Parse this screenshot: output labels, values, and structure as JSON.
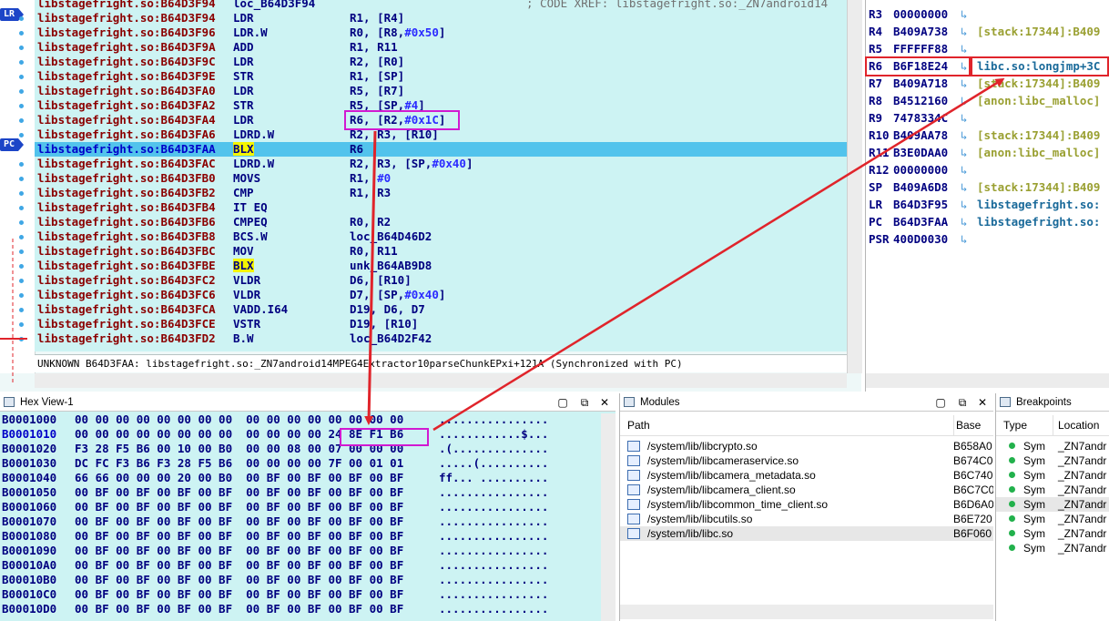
{
  "disasm": {
    "rows": [
      {
        "addr": "libstagefright.so:B64D3F94",
        "mn": "loc_B64D3F94",
        "ops": "",
        "cmt": "; CODE XREF: libstagefright.so:_ZN7android14"
      },
      {
        "addr": "libstagefright.so:B64D3F94",
        "mn": "LDR",
        "ops": "R1, [R4]"
      },
      {
        "addr": "libstagefright.so:B64D3F96",
        "mn": "LDR.W",
        "ops": "R0, [R8,",
        "imm": "#0x50",
        "tail": "]"
      },
      {
        "addr": "libstagefright.so:B64D3F9A",
        "mn": "ADD",
        "ops": "R1, R11"
      },
      {
        "addr": "libstagefright.so:B64D3F9C",
        "mn": "LDR",
        "ops": "R2, [R0]"
      },
      {
        "addr": "libstagefright.so:B64D3F9E",
        "mn": "STR",
        "ops": "R1, [SP]"
      },
      {
        "addr": "libstagefright.so:B64D3FA0",
        "mn": "LDR",
        "ops": "R5, [R7]"
      },
      {
        "addr": "libstagefright.so:B64D3FA2",
        "mn": "STR",
        "ops": "R5, [SP,",
        "imm": "#4",
        "tail": "]"
      },
      {
        "addr": "libstagefright.so:B64D3FA4",
        "mn": "LDR",
        "ops": "R6, [R2,",
        "imm": "#0x1C",
        "tail": "]"
      },
      {
        "addr": "libstagefright.so:B64D3FA6",
        "mn": "LDRD.W",
        "ops": "R2, R3, [R10]"
      },
      {
        "addr": "libstagefright.so:B64D3FAA",
        "mn": "BLX",
        "ops": "R6"
      },
      {
        "addr": "libstagefright.so:B64D3FAC",
        "mn": "LDRD.W",
        "ops": "R2, R3, [SP,",
        "imm": "#0x40",
        "tail": "]"
      },
      {
        "addr": "libstagefright.so:B64D3FB0",
        "mn": "MOVS",
        "ops": "R1, ",
        "imm": "#0",
        "tail": ""
      },
      {
        "addr": "libstagefright.so:B64D3FB2",
        "mn": "CMP",
        "ops": "R1, R3"
      },
      {
        "addr": "libstagefright.so:B64D3FB4",
        "mn": "IT EQ",
        "ops": ""
      },
      {
        "addr": "libstagefright.so:B64D3FB6",
        "mn": "CMPEQ",
        "ops": "R0, R2"
      },
      {
        "addr": "libstagefright.so:B64D3FB8",
        "mn": "BCS.W",
        "ops": "loc_B64D46D2"
      },
      {
        "addr": "libstagefright.so:B64D3FBC",
        "mn": "MOV",
        "ops": "R0, R11"
      },
      {
        "addr": "libstagefright.so:B64D3FBE",
        "mn": "BLX",
        "ops": "unk_B64AB9D8"
      },
      {
        "addr": "libstagefright.so:B64D3FC2",
        "mn": "VLDR",
        "ops": "D6, [R10]"
      },
      {
        "addr": "libstagefright.so:B64D3FC6",
        "mn": "VLDR",
        "ops": "D7, [SP,",
        "imm": "#0x40",
        "tail": "]"
      },
      {
        "addr": "libstagefright.so:B64D3FCA",
        "mn": "VADD.I64",
        "ops": "D19, D6, D7"
      },
      {
        "addr": "libstagefright.so:B64D3FCE",
        "mn": "VSTR",
        "ops": "D19, [R10]"
      },
      {
        "addr": "libstagefright.so:B64D3FD2",
        "mn": "B.W",
        "ops": "loc_B64D2F42"
      }
    ],
    "status": "UNKNOWN B64D3FAA: libstagefright.so:_ZN7android14MPEG4Extractor10parseChunkEPxi+121A (Synchronized with PC)",
    "gutter_lr": "LR",
    "gutter_pc": "PC"
  },
  "registers": [
    {
      "name": "R3",
      "value": "00000000",
      "desc": ""
    },
    {
      "name": "R4",
      "value": "B409A738",
      "desc": "[stack:17344]:B409"
    },
    {
      "name": "R5",
      "value": "FFFFFF88",
      "desc": ""
    },
    {
      "name": "R6",
      "value": "B6F18E24",
      "desc": "libc.so:longjmp+3C"
    },
    {
      "name": "R7",
      "value": "B409A718",
      "desc": "[stack:17344]:B409"
    },
    {
      "name": "R8",
      "value": "B4512160",
      "desc": "[anon:libc_malloc]"
    },
    {
      "name": "R9",
      "value": "7478334C",
      "desc": ""
    },
    {
      "name": "R10",
      "value": "B409AA78",
      "desc": "[stack:17344]:B409"
    },
    {
      "name": "R11",
      "value": "B3E0DAA0",
      "desc": "[anon:libc_malloc]"
    },
    {
      "name": "R12",
      "value": "00000000",
      "desc": ""
    },
    {
      "name": "SP",
      "value": "B409A6D8",
      "desc": "[stack:17344]:B409"
    },
    {
      "name": "LR",
      "value": "B64D3F95",
      "desc": "libstagefright.so:"
    },
    {
      "name": "PC",
      "value": "B64D3FAA",
      "desc": "libstagefright.so:"
    },
    {
      "name": "PSR",
      "value": "400D0030",
      "desc": ""
    }
  ],
  "hex": {
    "title": "Hex View-1",
    "rows": [
      {
        "addr": "B0001000",
        "bytes": "00 00 00 00 00 00 00 00  00 00 00 00 00 00 00 00",
        "ascii": "................"
      },
      {
        "addr": "B0001010",
        "bytes": "00 00 00 00 00 00 00 00  00 00 00 00 24 8E F1 B6",
        "ascii": "............$..."
      },
      {
        "addr": "B0001020",
        "bytes": "F3 28 F5 B6 00 10 00 B0  00 00 08 00 07 00 00 00",
        "ascii": ".(.............."
      },
      {
        "addr": "B0001030",
        "bytes": "DC FC F3 B6 F3 28 F5 B6  00 00 00 00 7F 00 01 01",
        "ascii": ".....(.........."
      },
      {
        "addr": "B0001040",
        "bytes": "66 66 00 00 00 20 00 B0  00 BF 00 BF 00 BF 00 BF",
        "ascii": "ff... .........."
      },
      {
        "addr": "B0001050",
        "bytes": "00 BF 00 BF 00 BF 00 BF  00 BF 00 BF 00 BF 00 BF",
        "ascii": "................"
      },
      {
        "addr": "B0001060",
        "bytes": "00 BF 00 BF 00 BF 00 BF  00 BF 00 BF 00 BF 00 BF",
        "ascii": "................"
      },
      {
        "addr": "B0001070",
        "bytes": "00 BF 00 BF 00 BF 00 BF  00 BF 00 BF 00 BF 00 BF",
        "ascii": "................"
      },
      {
        "addr": "B0001080",
        "bytes": "00 BF 00 BF 00 BF 00 BF  00 BF 00 BF 00 BF 00 BF",
        "ascii": "................"
      },
      {
        "addr": "B0001090",
        "bytes": "00 BF 00 BF 00 BF 00 BF  00 BF 00 BF 00 BF 00 BF",
        "ascii": "................"
      },
      {
        "addr": "B00010A0",
        "bytes": "00 BF 00 BF 00 BF 00 BF  00 BF 00 BF 00 BF 00 BF",
        "ascii": "................"
      },
      {
        "addr": "B00010B0",
        "bytes": "00 BF 00 BF 00 BF 00 BF  00 BF 00 BF 00 BF 00 BF",
        "ascii": "................"
      },
      {
        "addr": "B00010C0",
        "bytes": "00 BF 00 BF 00 BF 00 BF  00 BF 00 BF 00 BF 00 BF",
        "ascii": "................"
      },
      {
        "addr": "B00010D0",
        "bytes": "00 BF 00 BF 00 BF 00 BF  00 BF 00 BF 00 BF 00 BF",
        "ascii": "................"
      }
    ]
  },
  "modules": {
    "title": "Modules",
    "col_path": "Path",
    "col_base": "Base",
    "rows": [
      {
        "path": "/system/lib/libcrypto.so",
        "base": "B658A0"
      },
      {
        "path": "/system/lib/libcameraservice.so",
        "base": "B674C0"
      },
      {
        "path": "/system/lib/libcamera_metadata.so",
        "base": "B6C740"
      },
      {
        "path": "/system/lib/libcamera_client.so",
        "base": "B6C7C0"
      },
      {
        "path": "/system/lib/libcommon_time_client.so",
        "base": "B6D6A0"
      },
      {
        "path": "/system/lib/libcutils.so",
        "base": "B6E720"
      },
      {
        "path": "/system/lib/libc.so",
        "base": "B6F060"
      }
    ]
  },
  "breakpoints": {
    "title": "Breakpoints",
    "col_type": "Type",
    "col_location": "Location",
    "rows": [
      {
        "type": "Sym",
        "location": "_ZN7andr"
      },
      {
        "type": "Sym",
        "location": "_ZN7andr"
      },
      {
        "type": "Sym",
        "location": "_ZN7andr"
      },
      {
        "type": "Sym",
        "location": "_ZN7andr"
      },
      {
        "type": "Sym",
        "location": "_ZN7andr"
      },
      {
        "type": "Sym",
        "location": "_ZN7andr"
      },
      {
        "type": "Sym",
        "location": "_ZN7andr"
      },
      {
        "type": "Sym",
        "location": "_ZN7andr"
      }
    ]
  },
  "panel_buttons": {
    "close": "✕",
    "restore": "▢",
    "float": "⧉"
  },
  "colors": {
    "annotation_magenta": "#d11ad1",
    "annotation_red": "#e0242b",
    "pc_highlight": "#52c3ec"
  }
}
